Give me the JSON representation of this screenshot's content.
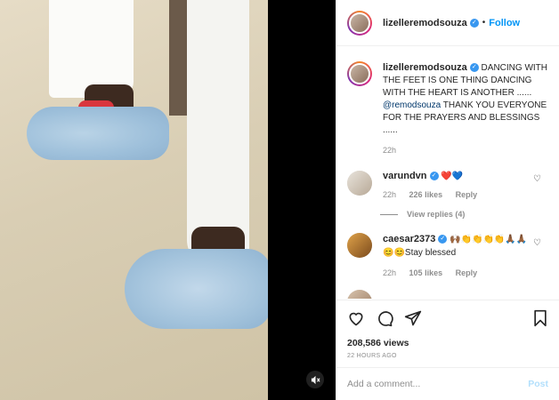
{
  "post": {
    "username": "lizelleremodsouza",
    "follow_label": "Follow",
    "dot": "•"
  },
  "caption": {
    "username": "lizelleremodsouza",
    "text_before": "DANCING WITH THE FEET IS ONE THING DANCING WITH THE HEART IS ANOTHER ......",
    "mention": "@remodsouza",
    "text_after": "THANK YOU EVERYONE FOR THE PRAYERS AND BLESSINGS ......",
    "time": "22h"
  },
  "comments": [
    {
      "username": "varundvn",
      "text": "❤️💙",
      "time": "22h",
      "likes": "226 likes",
      "reply_label": "Reply",
      "view_replies": "View replies (4)"
    },
    {
      "username": "caesar2373",
      "text": "🙌🏾👏👏👏👏🙏🏾🙏🏾",
      "text2": "😊😊Stay blessed",
      "time": "22h",
      "likes": "105 likes",
      "reply_label": "Reply"
    }
  ],
  "stats": {
    "views": "208,586 views",
    "ago": "22 HOURS AGO"
  },
  "composer": {
    "placeholder": "Add a comment...",
    "post_label": "Post"
  },
  "colors": {
    "accent": "#0095f6",
    "verified": "#3897f0",
    "post_disabled": "#b2dffc",
    "muted": "#8e8e8e"
  },
  "icons": [
    "heart-icon",
    "comment-icon",
    "share-icon",
    "bookmark-icon",
    "mute-icon",
    "verified-icon"
  ]
}
